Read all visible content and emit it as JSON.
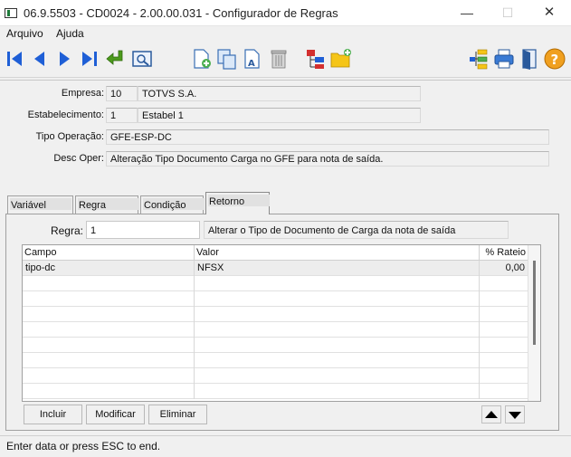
{
  "window": {
    "title": "06.9.5503 - CD0024 - 2.00.00.031 - Configurador de Regras",
    "minimize_glyph": "—",
    "maximize_glyph": "☐",
    "close_glyph": "✕"
  },
  "menu": {
    "items": [
      {
        "label": "Arquivo"
      },
      {
        "label": "Ajuda"
      }
    ]
  },
  "toolbar": {
    "icons": [
      "first-record-icon",
      "previous-record-icon",
      "next-record-icon",
      "last-record-icon",
      "confirm-return-icon",
      "search-icon",
      "new-document-icon",
      "copy-document-icon",
      "edit-text-icon",
      "trash-icon",
      "rule-tree-icon",
      "new-folder-icon",
      "hierarchy-icon",
      "print-icon",
      "exit-door-icon",
      "help-icon"
    ]
  },
  "header": {
    "empresa": {
      "label": "Empresa:",
      "code": "10",
      "name": "TOTVS S.A."
    },
    "estabelecimento": {
      "label": "Estabelecimento:",
      "code": "1",
      "name": "Estabel 1"
    },
    "tipo_operacao": {
      "label": "Tipo Operação:",
      "value": "GFE-ESP-DC"
    },
    "desc_oper": {
      "label": "Desc Oper:",
      "value": "Alteração Tipo Documento Carga no GFE para nota de saída."
    }
  },
  "tabs": [
    {
      "label": "Variável"
    },
    {
      "label": "Regra"
    },
    {
      "label": "Condição"
    },
    {
      "label": "Retorno",
      "active": true
    }
  ],
  "retorno": {
    "regra_label": "Regra:",
    "regra_value": "1",
    "regra_desc": "Alterar o Tipo de Documento de Carga da nota de saída",
    "grid": {
      "columns": [
        "Campo",
        "Valor",
        "% Rateio"
      ],
      "rows": [
        {
          "campo": "tipo-dc",
          "valor": "NFSX",
          "rateio": "0,00"
        }
      ]
    },
    "buttons": {
      "incluir": "Incluir",
      "modificar": "Modificar",
      "eliminar": "Eliminar"
    }
  },
  "status": {
    "message": "Enter data or press ESC to end."
  },
  "colors": {
    "nav_blue": "#1f5fd6",
    "confirm_green": "#4c9a1c",
    "help_orange": "#f0a020",
    "folder_yellow": "#f5c518"
  }
}
